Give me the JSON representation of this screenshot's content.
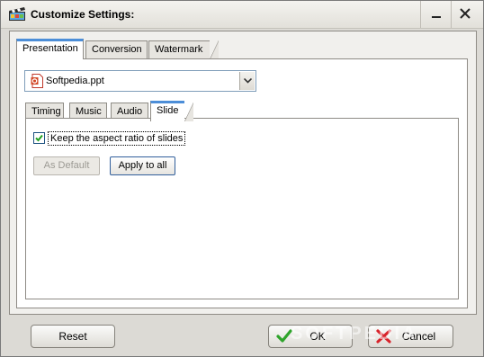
{
  "window": {
    "title": "Customize Settings:",
    "app_icon": "clapperboard-icon"
  },
  "title_controls": {
    "minimize_icon": "minimize-icon",
    "close_icon": "close-icon"
  },
  "outer_tabs": [
    {
      "label": "Presentation",
      "active": true
    },
    {
      "label": "Conversion",
      "active": false
    },
    {
      "label": "Watermark",
      "active": false
    }
  ],
  "file_select": {
    "value": "Softpedia.ppt",
    "icon": "powerpoint-file-icon"
  },
  "inner_tabs": [
    {
      "label": "Timing",
      "active": false
    },
    {
      "label": "Music",
      "active": false
    },
    {
      "label": "Audio",
      "active": false
    },
    {
      "label": "Slide",
      "active": true
    }
  ],
  "slide": {
    "keep_aspect_label": "Keep the aspect ratio of slides",
    "keep_aspect_checked": true,
    "as_default_label": "As Default",
    "apply_to_all_label": "Apply to all"
  },
  "footer": {
    "reset_label": "Reset",
    "ok_label": "OK",
    "cancel_label": "Cancel"
  },
  "watermark_text": "SOFTPEDIA",
  "colors": {
    "tab_accent": "#4c8ed8",
    "ok_check": "#2ea42b",
    "cancel_x": "#d8232a"
  }
}
